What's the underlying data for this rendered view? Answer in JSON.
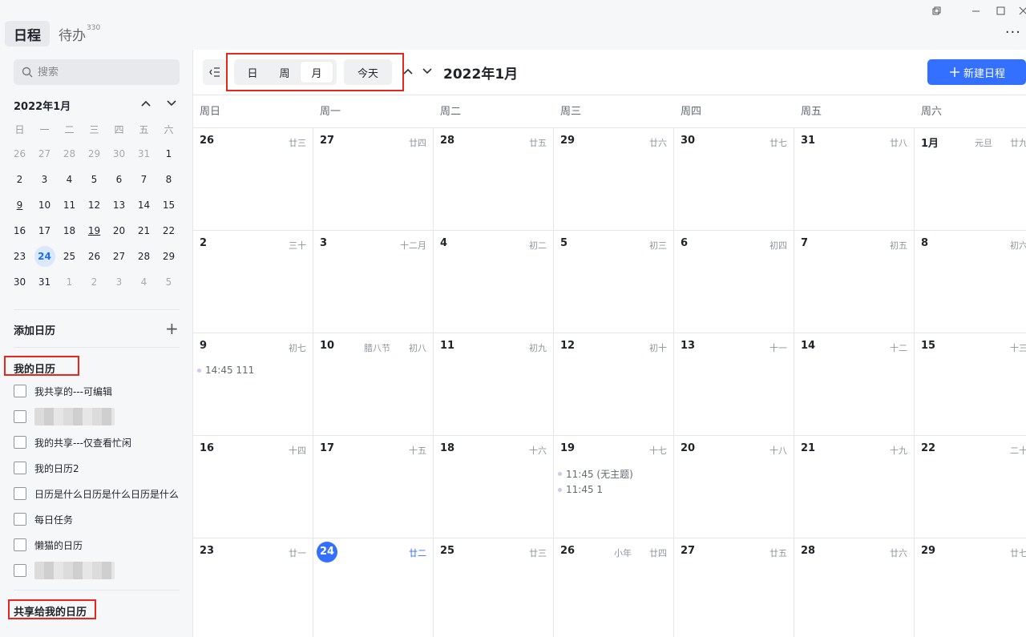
{
  "app": {
    "tabs": [
      {
        "label": "日程"
      },
      {
        "label": "待办",
        "badge": "330"
      }
    ],
    "more_label": "···"
  },
  "sidebar": {
    "search_placeholder": "搜索",
    "mini_calendar": {
      "title": "2022年1月",
      "weekday_headers": [
        "日",
        "一",
        "二",
        "三",
        "四",
        "五",
        "六"
      ],
      "weeks": [
        [
          "26",
          "27",
          "28",
          "29",
          "30",
          "31",
          "1"
        ],
        [
          "2",
          "3",
          "4",
          "5",
          "6",
          "7",
          "8"
        ],
        [
          "9",
          "10",
          "11",
          "12",
          "13",
          "14",
          "15"
        ],
        [
          "16",
          "17",
          "18",
          "19",
          "20",
          "21",
          "22"
        ],
        [
          "23",
          "24",
          "25",
          "26",
          "27",
          "28",
          "29"
        ],
        [
          "30",
          "31",
          "1",
          "2",
          "3",
          "4",
          "5"
        ]
      ],
      "today": "24"
    },
    "add_calendar_label": "添加日历",
    "my_calendars_title": "我的日历",
    "my_calendars": [
      {
        "label": "我共享的---可编辑"
      },
      {
        "label": ""
      },
      {
        "label": "我的共享---仅查看忙闲"
      },
      {
        "label": "我的日历2"
      },
      {
        "label": "日历是什么日历是什么日历是什么"
      },
      {
        "label": "每日任务"
      },
      {
        "label": "懒猫的日历"
      },
      {
        "label": ""
      }
    ],
    "shared_calendars_title": "共享给我的日历"
  },
  "toolbar": {
    "views": [
      "日",
      "周",
      "月"
    ],
    "active_view": "月",
    "today_label": "今天",
    "month_title": "2022年1月",
    "new_event_label": "新建日程"
  },
  "month_view": {
    "weekday_headers": [
      "周日",
      "周一",
      "周二",
      "周三",
      "周四",
      "周五",
      "周六"
    ],
    "weeks": [
      [
        {
          "num": "26",
          "lunar": "廿三"
        },
        {
          "num": "27",
          "lunar": "廿四"
        },
        {
          "num": "28",
          "lunar": "廿五"
        },
        {
          "num": "29",
          "lunar": "廿六"
        },
        {
          "num": "30",
          "lunar": "廿七"
        },
        {
          "num": "31",
          "lunar": "廿八"
        },
        {
          "num": "1月",
          "lunar": "廿九",
          "holiday": "元旦"
        }
      ],
      [
        {
          "num": "2",
          "lunar": "三十"
        },
        {
          "num": "3",
          "lunar": "十二月"
        },
        {
          "num": "4",
          "lunar": "初二"
        },
        {
          "num": "5",
          "lunar": "初三"
        },
        {
          "num": "6",
          "lunar": "初四"
        },
        {
          "num": "7",
          "lunar": "初五"
        },
        {
          "num": "8",
          "lunar": "初六"
        }
      ],
      [
        {
          "num": "9",
          "lunar": "初七",
          "events": [
            "14:45 111"
          ]
        },
        {
          "num": "10",
          "lunar": "初八",
          "holiday": "腊八节"
        },
        {
          "num": "11",
          "lunar": "初九"
        },
        {
          "num": "12",
          "lunar": "初十"
        },
        {
          "num": "13",
          "lunar": "十一"
        },
        {
          "num": "14",
          "lunar": "十二"
        },
        {
          "num": "15",
          "lunar": "十三"
        }
      ],
      [
        {
          "num": "16",
          "lunar": "十四"
        },
        {
          "num": "17",
          "lunar": "十五"
        },
        {
          "num": "18",
          "lunar": "十六"
        },
        {
          "num": "19",
          "lunar": "十七",
          "events": [
            "11:45 (无主题)",
            "11:45 1"
          ]
        },
        {
          "num": "20",
          "lunar": "十八"
        },
        {
          "num": "21",
          "lunar": "十九"
        },
        {
          "num": "22",
          "lunar": "二十"
        }
      ],
      [
        {
          "num": "23",
          "lunar": "廿一"
        },
        {
          "num": "24",
          "lunar": "廿二",
          "today": true
        },
        {
          "num": "25",
          "lunar": "廿三"
        },
        {
          "num": "26",
          "lunar": "廿四",
          "holiday": "小年"
        },
        {
          "num": "27",
          "lunar": "廿五"
        },
        {
          "num": "28",
          "lunar": "廿六"
        },
        {
          "num": "29",
          "lunar": "廿七"
        }
      ]
    ]
  },
  "colors": {
    "accent": "#3370ff",
    "highlight_box": "#e8261e",
    "event_dot": "#d6c3f0"
  }
}
